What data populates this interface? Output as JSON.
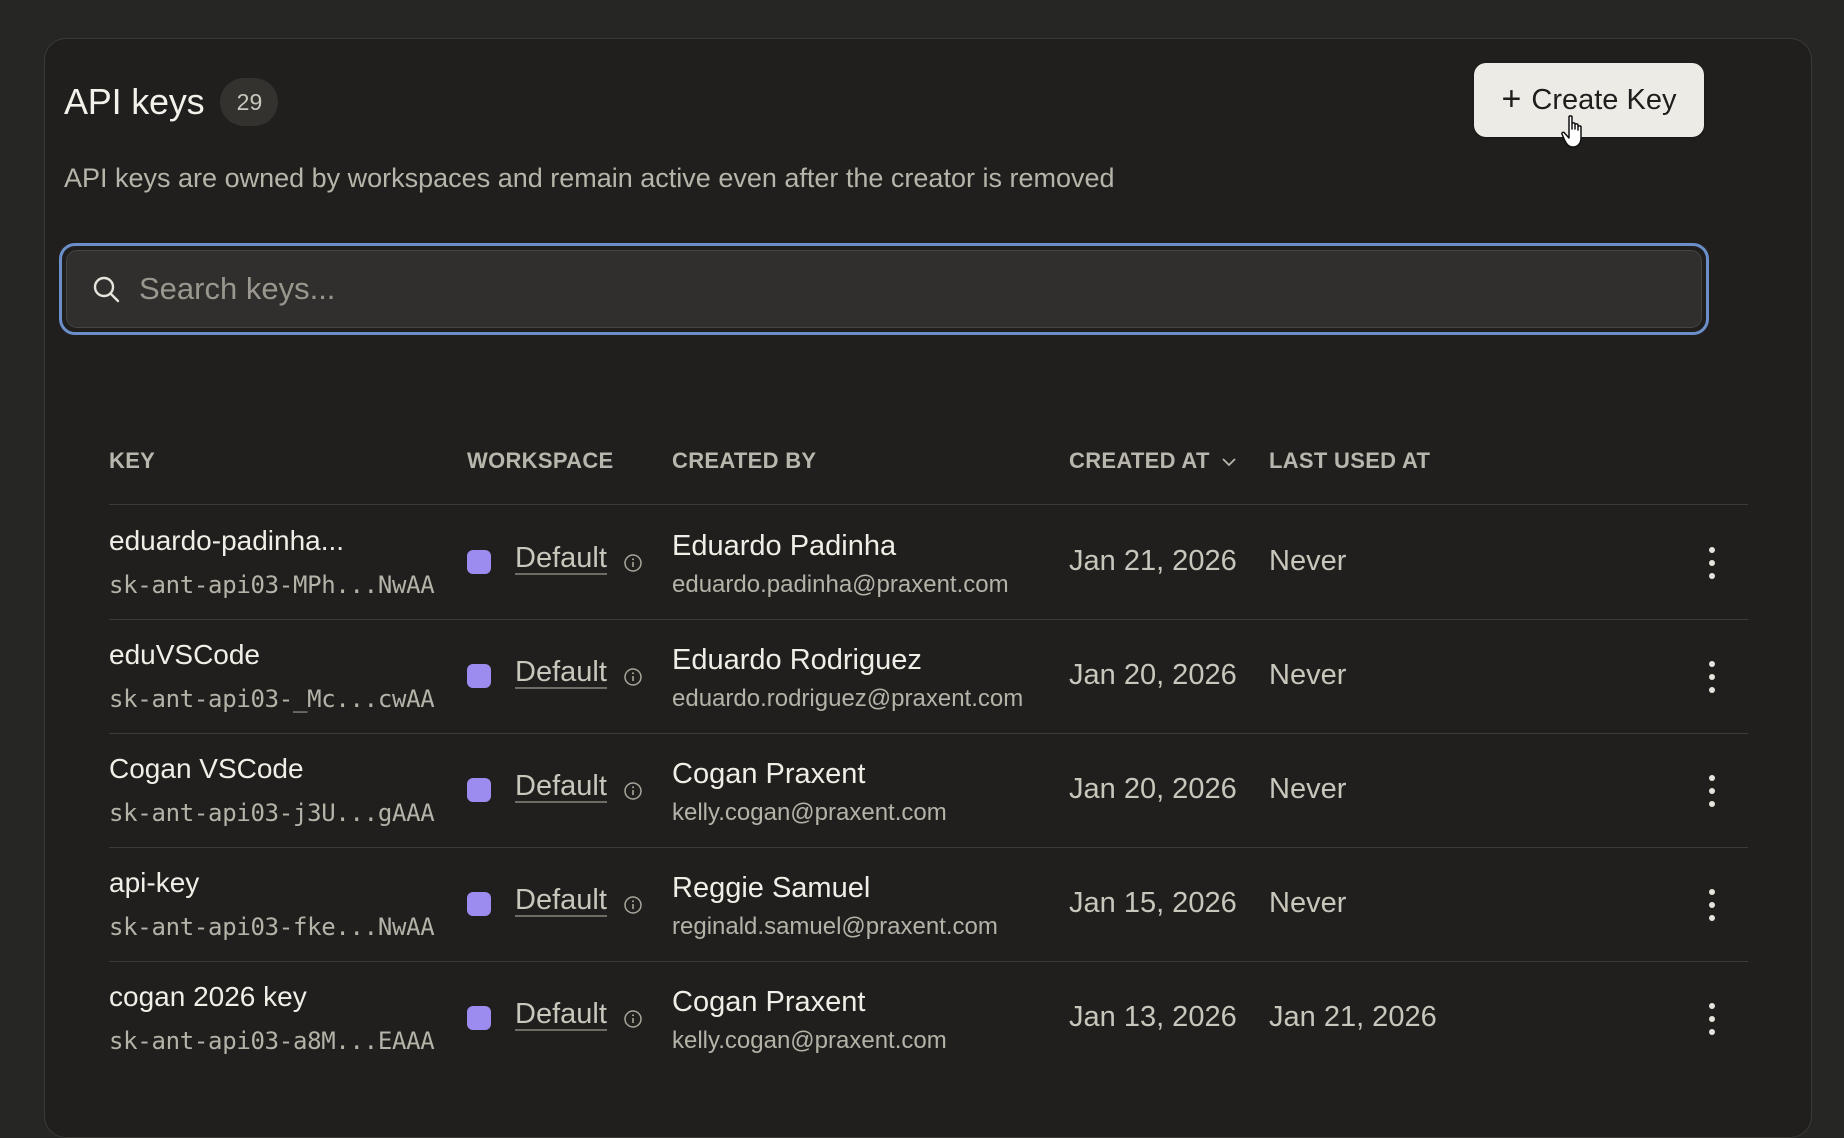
{
  "header": {
    "title": "API keys",
    "count": "29",
    "subtitle": "API keys are owned by workspaces and remain active even after the creator is removed",
    "create_label": "Create Key"
  },
  "search": {
    "placeholder": "Search keys..."
  },
  "columns": {
    "key": "KEY",
    "workspace": "WORKSPACE",
    "created_by": "CREATED BY",
    "created_at": "CREATED AT",
    "last_used_at": "LAST USED AT"
  },
  "rows": [
    {
      "name": "eduardo-padinha...",
      "key_id": "sk-ant-api03-MPh...NwAA",
      "workspace": "Default",
      "creator_name": "Eduardo Padinha",
      "creator_email": "eduardo.padinha@praxent.com",
      "created_at": "Jan 21, 2026",
      "last_used_at": "Never"
    },
    {
      "name": "eduVSCode",
      "key_id": "sk-ant-api03-_Mc...cwAA",
      "workspace": "Default",
      "creator_name": "Eduardo Rodriguez",
      "creator_email": "eduardo.rodriguez@praxent.com",
      "created_at": "Jan 20, 2026",
      "last_used_at": "Never"
    },
    {
      "name": "Cogan VSCode",
      "key_id": "sk-ant-api03-j3U...gAAA",
      "workspace": "Default",
      "creator_name": "Cogan Praxent",
      "creator_email": "kelly.cogan@praxent.com",
      "created_at": "Jan 20, 2026",
      "last_used_at": "Never"
    },
    {
      "name": "api-key",
      "key_id": "sk-ant-api03-fke...NwAA",
      "workspace": "Default",
      "creator_name": "Reggie Samuel",
      "creator_email": "reginald.samuel@praxent.com",
      "created_at": "Jan 15, 2026",
      "last_used_at": "Never"
    },
    {
      "name": "cogan 2026 key",
      "key_id": "sk-ant-api03-a8M...EAAA",
      "workspace": "Default",
      "creator_name": "Cogan Praxent",
      "creator_email": "kelly.cogan@praxent.com",
      "created_at": "Jan 13, 2026",
      "last_used_at": "Jan 21, 2026"
    }
  ],
  "colors": {
    "workspace_dot": "#9d8cf0",
    "focus_ring": "#6b8fca"
  }
}
